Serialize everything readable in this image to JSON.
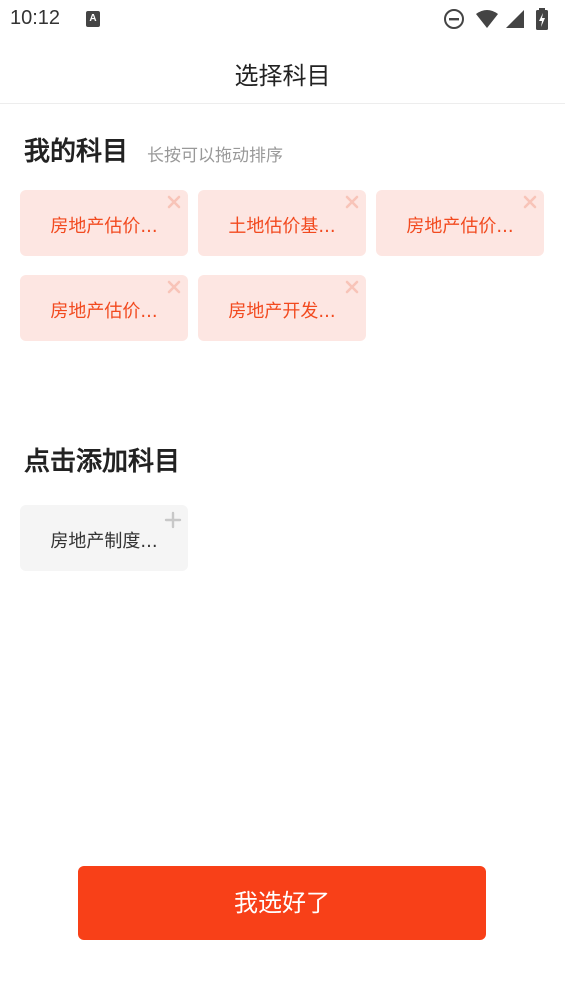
{
  "status_bar": {
    "time": "10:12",
    "notification_icon": "a-icon",
    "notification_letter": "A",
    "icons": [
      "do-not-disturb-icon",
      "wifi-icon",
      "signal-icon",
      "battery-charging-icon"
    ]
  },
  "header": {
    "title": "选择科目"
  },
  "my_subjects": {
    "title": "我的科目",
    "hint": "长按可以拖动排序",
    "items": [
      {
        "label": "房地产估价..."
      },
      {
        "label": "土地估价基..."
      },
      {
        "label": "房地产估价..."
      },
      {
        "label": "房地产估价..."
      },
      {
        "label": "房地产开发..."
      }
    ]
  },
  "add_subjects": {
    "title": "点击添加科目",
    "items": [
      {
        "label": "房地产制度..."
      }
    ]
  },
  "confirm_button": {
    "label": "我选好了"
  },
  "colors": {
    "accent": "#f84018",
    "chip_selected_bg": "#fde6e2",
    "chip_selected_text": "#f24a1f",
    "chip_available_bg": "#f5f5f5"
  }
}
